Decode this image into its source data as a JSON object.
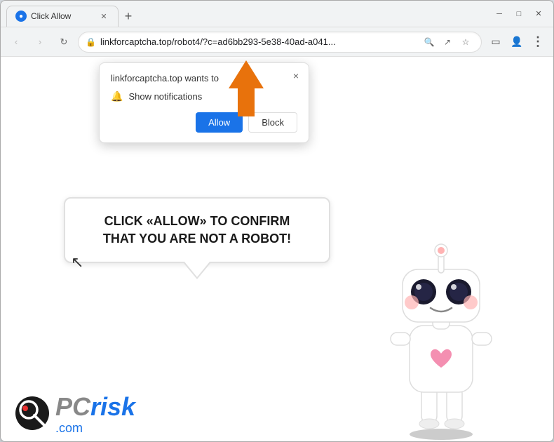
{
  "browser": {
    "tab": {
      "title": "Click Allow",
      "favicon": "◉"
    },
    "url": "linkforcaptcha.top/robot4/?c=ad6bb293-5e38-40ad-a041...",
    "url_short": "linkforcaptcha.top/robot4/?c=ad6bb293-5e38-40ad-a041...",
    "new_tab_label": "+"
  },
  "nav": {
    "back": "‹",
    "forward": "›",
    "refresh": "↻"
  },
  "toolbar": {
    "search_icon": "⌕",
    "share_icon": "⎋",
    "bookmark_icon": "☆",
    "extension_icon": "▭",
    "profile_icon": "⊙",
    "menu_icon": "⋮",
    "window_min": "─",
    "window_max": "□",
    "window_close": "✕"
  },
  "popup": {
    "title": "linkforcaptcha.top wants to",
    "close_label": "×",
    "notification_text": "Show notifications",
    "allow_label": "Allow",
    "block_label": "Block"
  },
  "page": {
    "speech_text": "CLICK «ALLOW» TO CONFIRM THAT YOU ARE NOT A ROBOT!",
    "cursor_symbol": "↖"
  },
  "logo": {
    "pc": "PC",
    "risk": "risk",
    "dot_com": ".com"
  }
}
